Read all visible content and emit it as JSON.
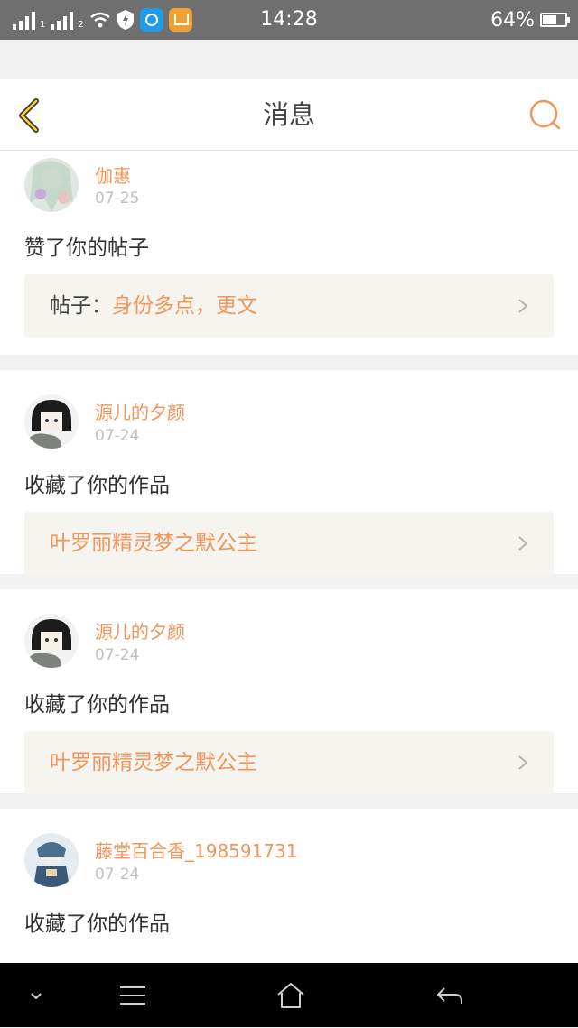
{
  "status_bar": {
    "sim1_label": "1",
    "sim2_label": "2",
    "time": "14:28",
    "battery_percent": "64%",
    "battery_level": 0.64
  },
  "header": {
    "title": "消息",
    "back_icon": "back-chevron-icon",
    "search_icon": "search-icon"
  },
  "messages": [
    {
      "user": "伽惠",
      "date": "07-25",
      "action": "赞了你的帖子",
      "ref_prefix": "帖子：",
      "ref_title": "身份多点，更文"
    },
    {
      "user": "源儿的夕颜",
      "date": "07-24",
      "action": "收藏了你的作品",
      "ref_prefix": "",
      "ref_title": "叶罗丽精灵梦之默公主"
    },
    {
      "user": "源儿的夕颜",
      "date": "07-24",
      "action": "收藏了你的作品",
      "ref_prefix": "",
      "ref_title": "叶罗丽精灵梦之默公主"
    },
    {
      "user": "藤堂百合香_198591731",
      "date": "07-24",
      "action": "收藏了你的作品",
      "ref_prefix": "",
      "ref_title": ""
    }
  ],
  "colors": {
    "accent": "#f0955b",
    "status_bar": "#6f6f6f",
    "ref_background": "#f5f4ef"
  }
}
